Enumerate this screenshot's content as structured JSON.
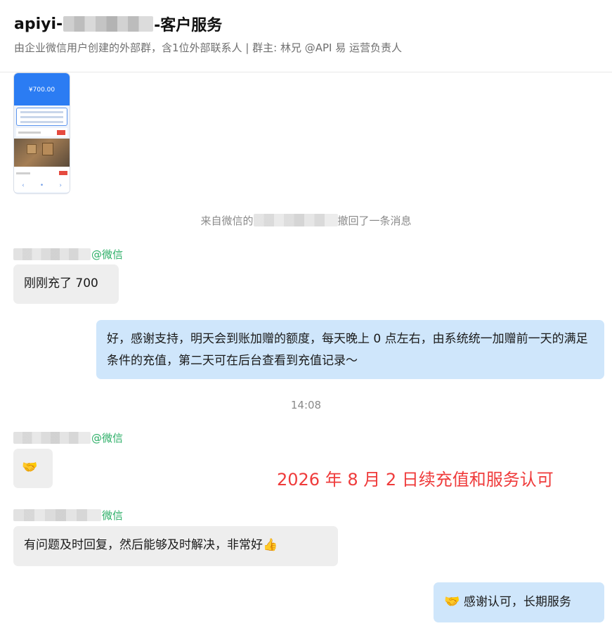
{
  "header": {
    "title_prefix": "apiyi-",
    "title_suffix": "-客户服务",
    "subtitle": "由企业微信用户创建的外部群，含1位外部联系人 | 群主: 林兄 @API 易 运营负责人"
  },
  "image_message": {
    "amount": "¥700.00"
  },
  "notice": {
    "prefix": "来自微信的",
    "suffix": "撤回了一条消息"
  },
  "messages": [
    {
      "sender_suffix": "@微信",
      "text": "刚刚充了 700"
    },
    {
      "text": "好，感谢支持，明天会到账加赠的额度，每天晚上 0 点左右，由系统统一加赠前一天的满足条件的充值，第二天可在后台查看到充值记录～"
    },
    {
      "sender_suffix": "@微信",
      "emoji": "🤝"
    },
    {
      "sender_suffix": "微信",
      "text": "有问题及时回复，然后能够及时解决，非常好👍"
    },
    {
      "emoji": "🤝",
      "text": "感谢认可，长期服务"
    }
  ],
  "timestamp": "14:08",
  "annotation": "2026 年 8 月 2 日续充值和服务认可",
  "colors": {
    "incoming_bubble": "#eeeeee",
    "outgoing_bubble": "#cfe6fb",
    "sender_name": "#2bae66",
    "annotation": "#ef3b3b"
  }
}
